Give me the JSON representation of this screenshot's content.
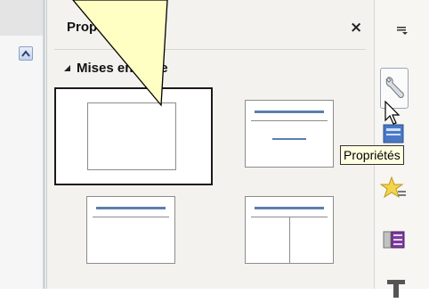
{
  "panel": {
    "title": "Propriétés",
    "close_label": "×",
    "section_label": "Mises en page"
  },
  "layouts": [
    {
      "name": "Diapositive vide",
      "selected": true
    },
    {
      "name": "Titre, contenu",
      "selected": false
    },
    {
      "name": "Titre, contenu",
      "selected": false
    },
    {
      "name": "Titre et 2 contenus",
      "selected": false
    }
  ],
  "sidebar": {
    "menu_icon": "menu-icon",
    "buttons": [
      {
        "icon": "wrench-icon",
        "active": true
      },
      {
        "icon": "slide-layout-icon"
      },
      {
        "icon": "star-icon"
      },
      {
        "icon": "navigator-icon"
      },
      {
        "icon": "text-icon"
      }
    ]
  },
  "tooltip": {
    "text": "Propriétés"
  },
  "colors": {
    "accent_bar": "#5a7fae",
    "panel_bg": "#f3f2ee",
    "tooltip_bg": "#ffffe1",
    "callout_fill": "#ffffc4"
  }
}
